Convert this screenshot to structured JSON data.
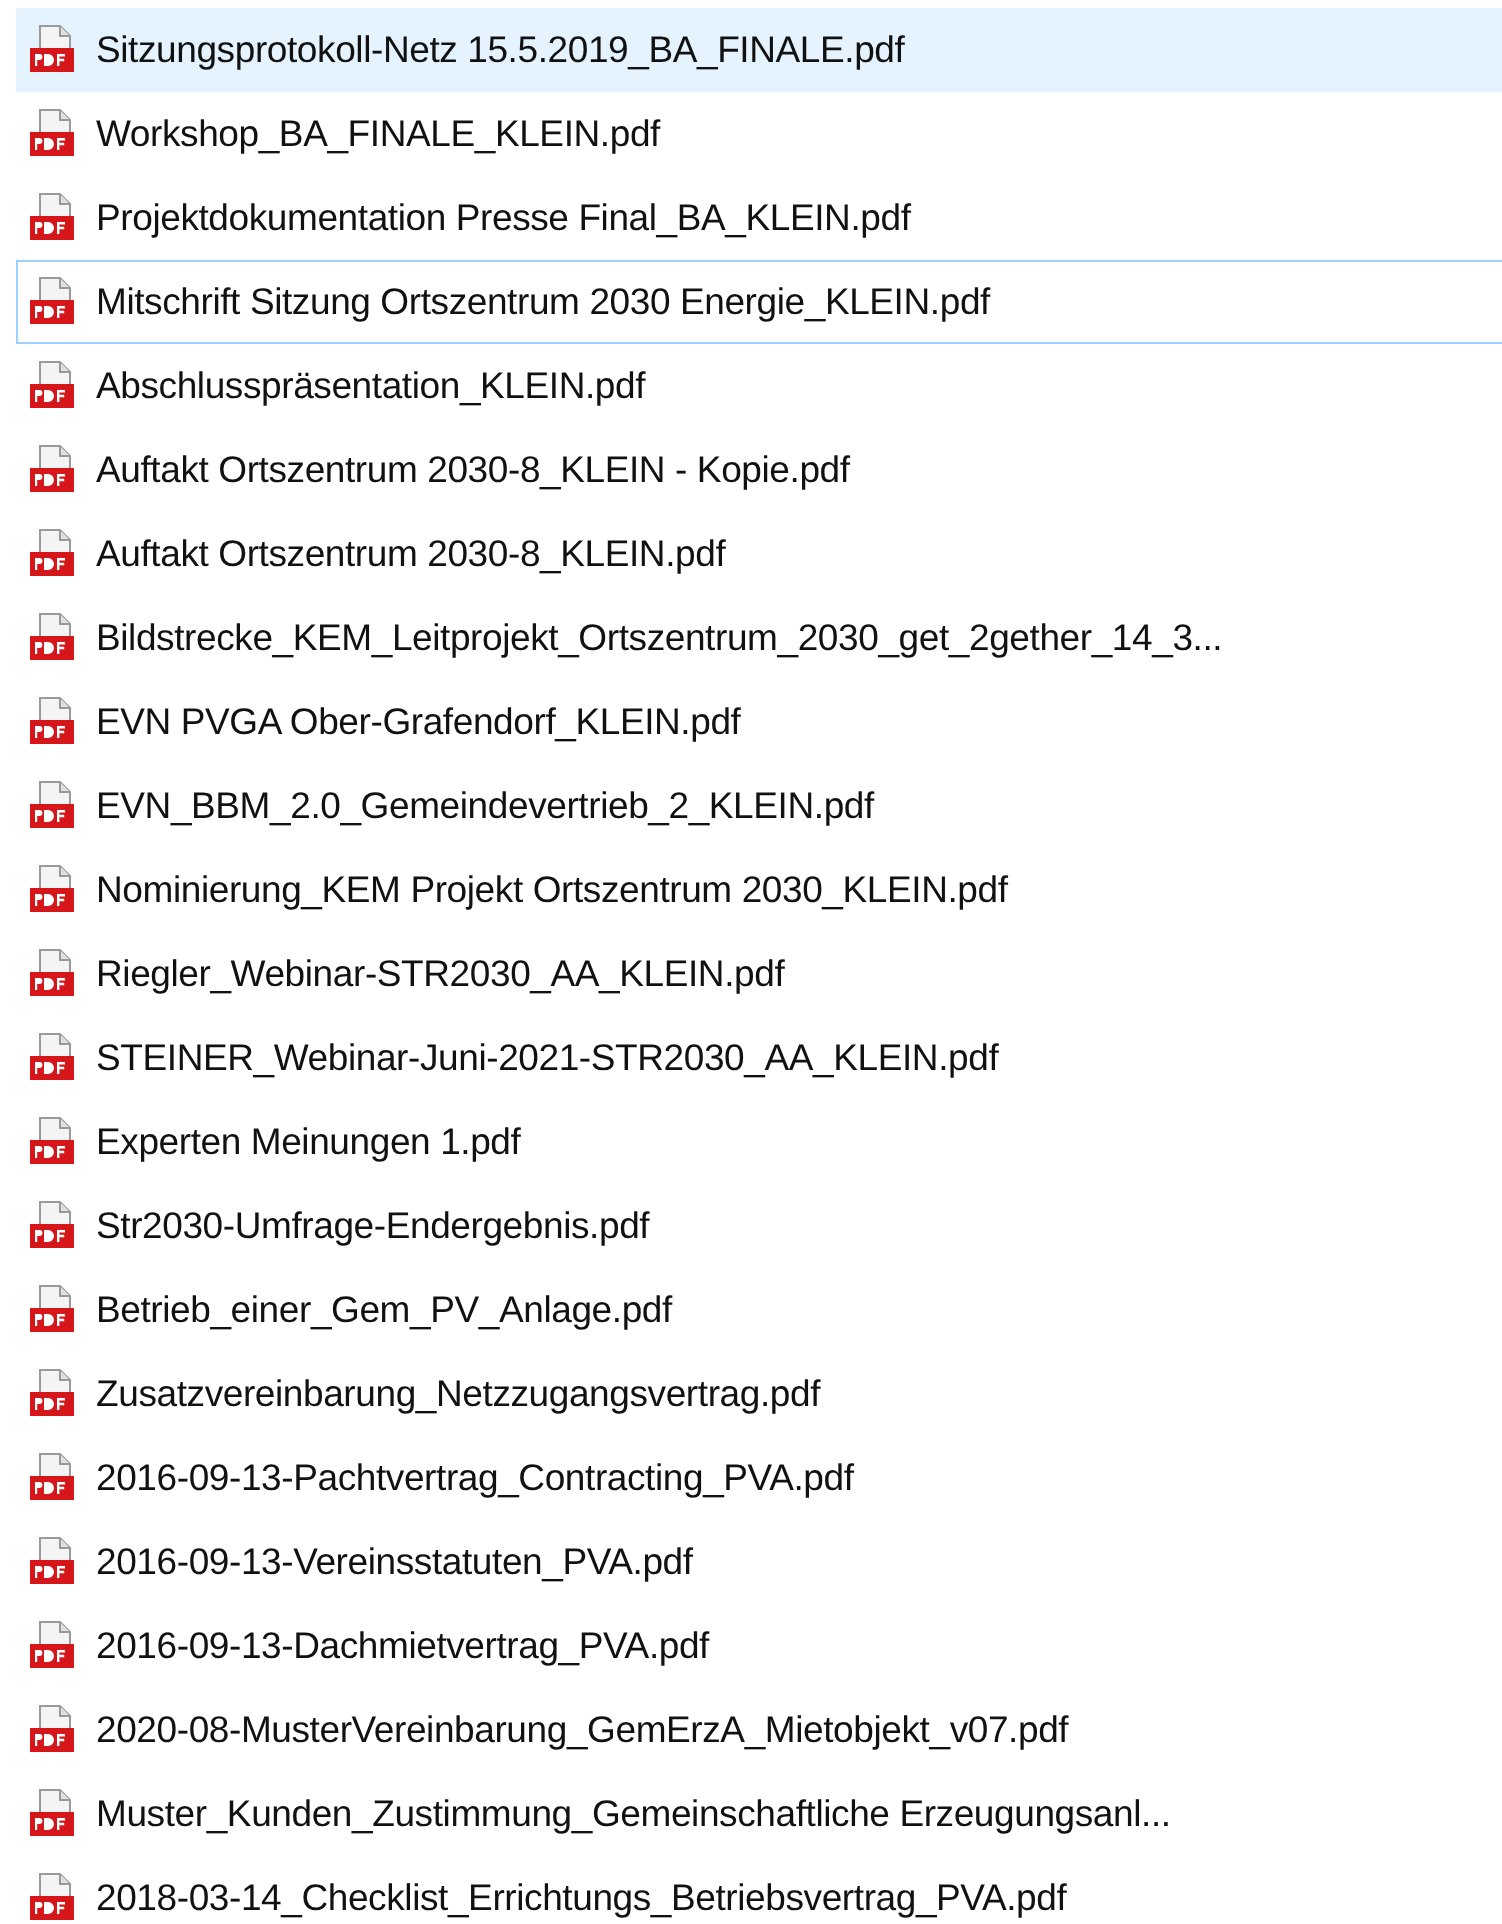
{
  "files": [
    {
      "name": "Sitzungsprotokoll-Netz 15.5.2019_BA_FINALE.pdf",
      "selected": true,
      "focused": false
    },
    {
      "name": "Workshop_BA_FINALE_KLEIN.pdf",
      "selected": false,
      "focused": false
    },
    {
      "name": "Projektdokumentation Presse Final_BA_KLEIN.pdf",
      "selected": false,
      "focused": false
    },
    {
      "name": "Mitschrift Sitzung Ortszentrum 2030 Energie_KLEIN.pdf",
      "selected": false,
      "focused": true
    },
    {
      "name": "Abschlusspräsentation_KLEIN.pdf",
      "selected": false,
      "focused": false
    },
    {
      "name": "Auftakt Ortszentrum 2030-8_KLEIN - Kopie.pdf",
      "selected": false,
      "focused": false
    },
    {
      "name": "Auftakt Ortszentrum 2030-8_KLEIN.pdf",
      "selected": false,
      "focused": false
    },
    {
      "name": "Bildstrecke_KEM_Leitprojekt_Ortszentrum_2030_get_2gether_14_3...",
      "selected": false,
      "focused": false
    },
    {
      "name": "EVN PVGA Ober-Grafendorf_KLEIN.pdf",
      "selected": false,
      "focused": false
    },
    {
      "name": "EVN_BBM_2.0_Gemeindevertrieb_2_KLEIN.pdf",
      "selected": false,
      "focused": false
    },
    {
      "name": "Nominierung_KEM Projekt Ortszentrum 2030_KLEIN.pdf",
      "selected": false,
      "focused": false
    },
    {
      "name": "Riegler_Webinar-STR2030_AA_KLEIN.pdf",
      "selected": false,
      "focused": false
    },
    {
      "name": "STEINER_Webinar-Juni-2021-STR2030_AA_KLEIN.pdf",
      "selected": false,
      "focused": false
    },
    {
      "name": "Experten Meinungen 1.pdf",
      "selected": false,
      "focused": false
    },
    {
      "name": "Str2030-Umfrage-Endergebnis.pdf",
      "selected": false,
      "focused": false
    },
    {
      "name": "Betrieb_einer_Gem_PV_Anlage.pdf",
      "selected": false,
      "focused": false
    },
    {
      "name": "Zusatzvereinbarung_Netzzugangsvertrag.pdf",
      "selected": false,
      "focused": false
    },
    {
      "name": "2016-09-13-Pachtvertrag_Contracting_PVA.pdf",
      "selected": false,
      "focused": false
    },
    {
      "name": "2016-09-13-Vereinsstatuten_PVA.pdf",
      "selected": false,
      "focused": false
    },
    {
      "name": "2016-09-13-Dachmietvertrag_PVA.pdf",
      "selected": false,
      "focused": false
    },
    {
      "name": "2020-08-MusterVereinbarung_GemErzA_Mietobjekt_v07.pdf",
      "selected": false,
      "focused": false
    },
    {
      "name": "Muster_Kunden_Zustimmung_Gemeinschaftliche Erzeugungsanl...",
      "selected": false,
      "focused": false
    },
    {
      "name": "2018-03-14_Checklist_Errichtungs_Betriebsvertrag_PVA.pdf",
      "selected": false,
      "focused": false
    }
  ]
}
